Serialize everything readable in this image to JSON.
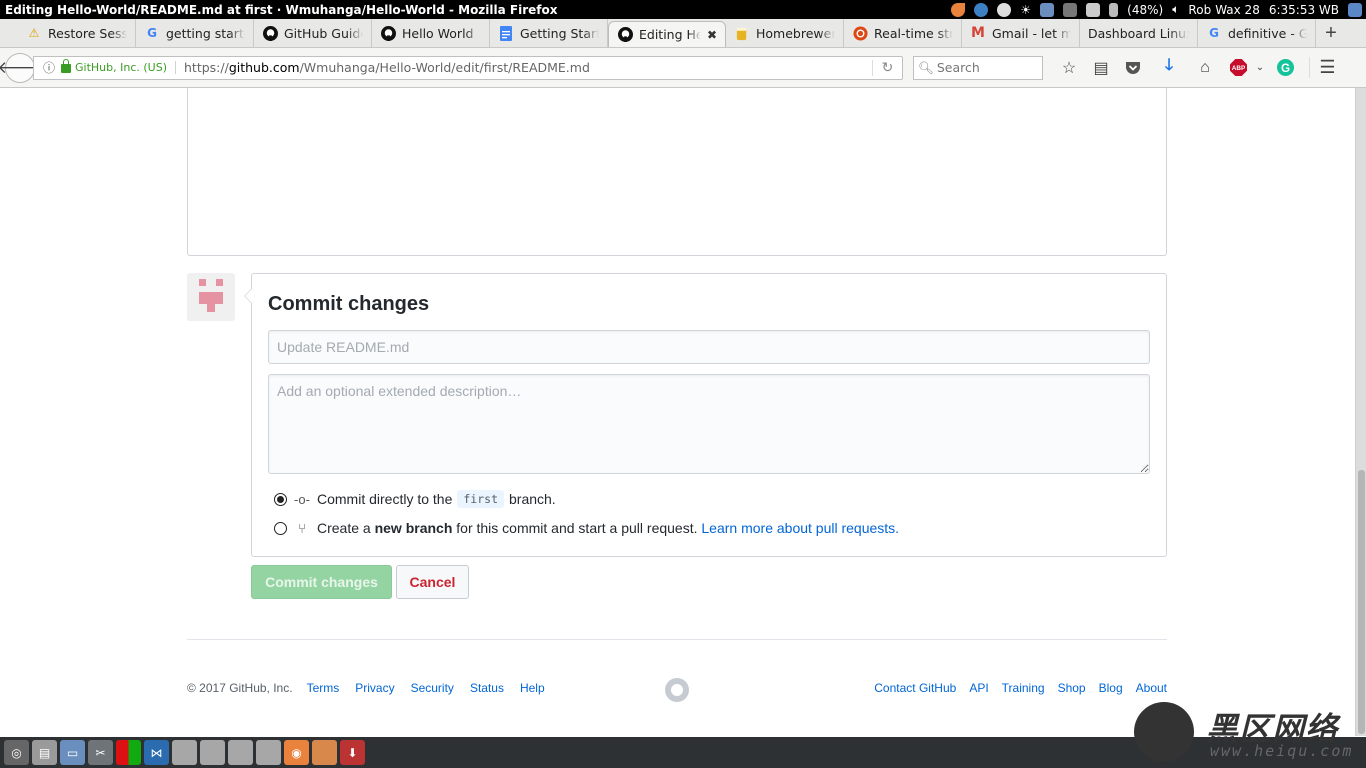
{
  "os": {
    "window_title": "Editing Hello-World/README.md at first · Wmuhanga/Hello-World - Mozilla Firefox",
    "battery": "(48%)",
    "user": "Rob",
    "date": "Wax 28",
    "time": "6:35:53 WB"
  },
  "tabs": [
    {
      "label": "Restore Session",
      "icon": "warning-icon"
    },
    {
      "label": "getting started",
      "icon": "google-icon"
    },
    {
      "label": "GitHub Guides",
      "icon": "github-icon"
    },
    {
      "label": "Hello World",
      "icon": "github-icon"
    },
    {
      "label": "Getting Started",
      "icon": "docs-icon"
    },
    {
      "label": "Editing Hello-World",
      "icon": "github-icon",
      "active": true
    },
    {
      "label": "Homebrewer",
      "icon": "beer-icon"
    },
    {
      "label": "Real-time stream",
      "icon": "ubuntu-icon"
    },
    {
      "label": "Gmail - let me",
      "icon": "gmail-icon"
    },
    {
      "label": "Dashboard Linux",
      "icon": ""
    },
    {
      "label": "definitive - Google",
      "icon": "google-icon"
    }
  ],
  "navbar": {
    "identity": "GitHub, Inc. (US)",
    "url_prefix": "https://",
    "url_domain": "github.com",
    "url_path": "/Wmuhanga/Hello-World/edit/first/README.md",
    "search_placeholder": "Search"
  },
  "commit": {
    "title": "Commit changes",
    "summary_placeholder": "Update README.md",
    "description_placeholder": "Add an optional extended description…",
    "option_direct_prefix": "Commit directly to the",
    "branch_name": "first",
    "option_direct_suffix": "branch.",
    "option_new_prefix": "Create a",
    "option_new_bold": "new branch",
    "option_new_suffix": "for this commit and start a pull request.",
    "option_new_link": "Learn more about pull requests.",
    "selected_option": "direct",
    "commit_button": "Commit changes",
    "cancel_button": "Cancel"
  },
  "footer": {
    "copyright": "© 2017 GitHub, Inc.",
    "left_links": [
      "Terms",
      "Privacy",
      "Security",
      "Status",
      "Help"
    ],
    "right_links": [
      "Contact GitHub",
      "API",
      "Training",
      "Shop",
      "Blog",
      "About"
    ]
  },
  "scroll": {
    "position_fraction": 1.0
  },
  "watermark": {
    "cn": "黑区网络",
    "en": "www.heiqu.com"
  },
  "colors": {
    "link": "#0366d6",
    "commit_button_disabled": "#94d3a2",
    "cancel_text": "#cb2431",
    "secure": "#3a9d23"
  }
}
